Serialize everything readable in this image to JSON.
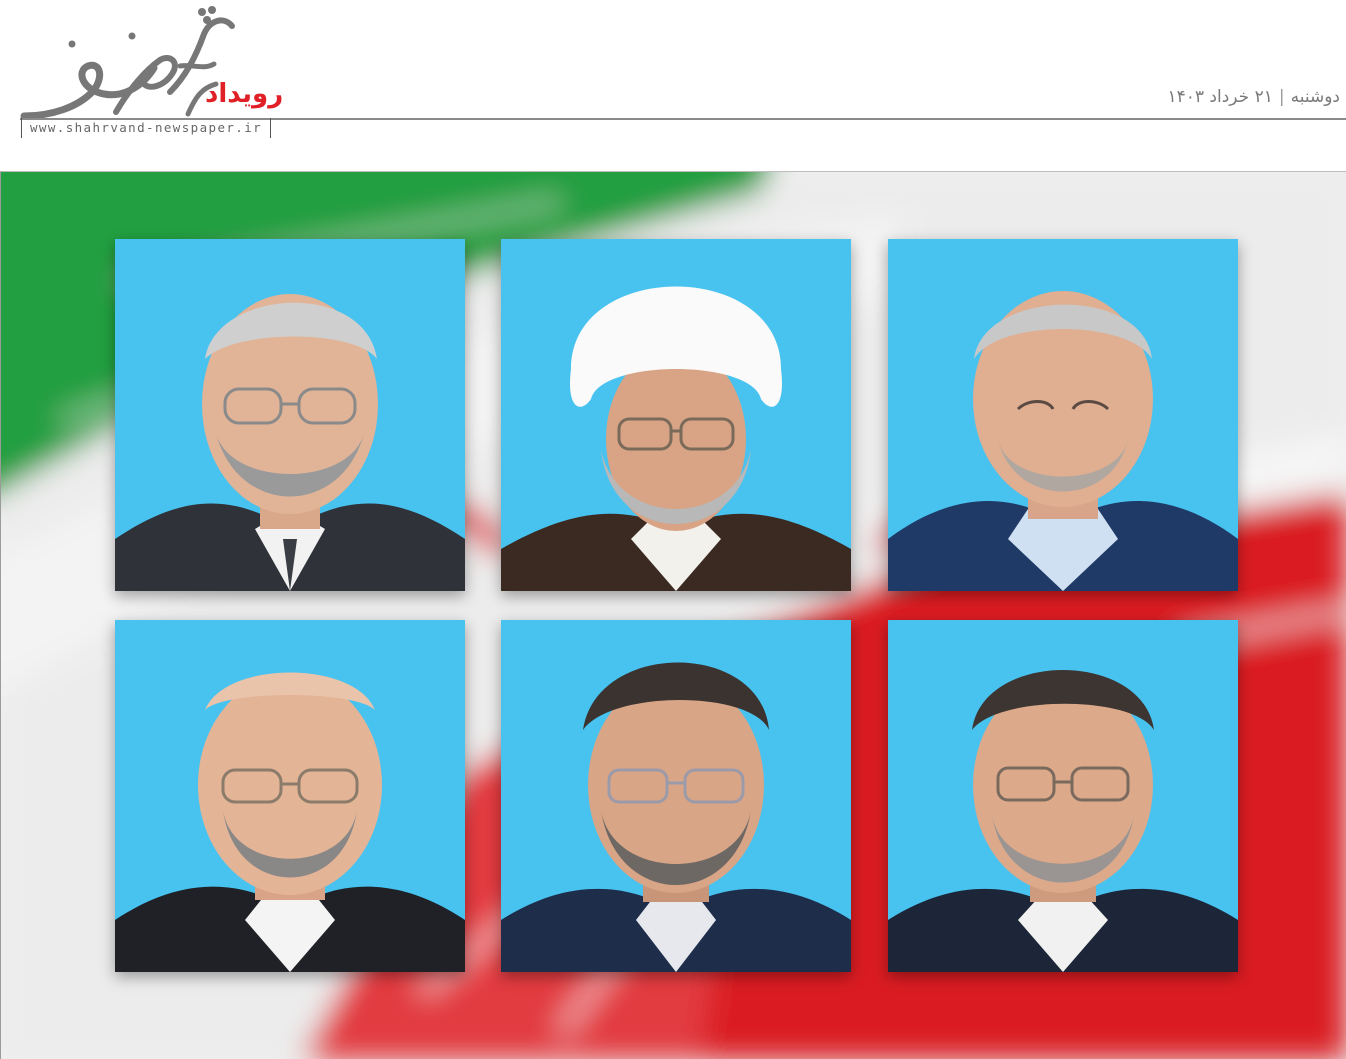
{
  "header": {
    "section_label": "رویداد",
    "website": "www.shahrvand-newspaper.ir",
    "weekday": "دوشنبه",
    "separator": "|",
    "date": "۲۱ خرداد ۱۴۰۳",
    "logo_icon": "shahrvand-calligraphic-logo"
  },
  "colors": {
    "accent_red": "#e01f26",
    "portrait_background": "#48c2ef",
    "flag_green": "#239f40",
    "flag_red": "#da0000"
  },
  "hero": {
    "background_icon": "iran-flag",
    "portraits": [
      {
        "row": 1,
        "col": 1,
        "attire": "suit-tie",
        "headwear": "none"
      },
      {
        "row": 1,
        "col": 2,
        "attire": "clerical-robe",
        "headwear": "white-turban"
      },
      {
        "row": 1,
        "col": 3,
        "attire": "jacket-open-collar",
        "headwear": "none"
      },
      {
        "row": 2,
        "col": 1,
        "attire": "suit",
        "headwear": "none"
      },
      {
        "row": 2,
        "col": 2,
        "attire": "suit",
        "headwear": "none"
      },
      {
        "row": 2,
        "col": 3,
        "attire": "suit",
        "headwear": "none"
      }
    ]
  }
}
